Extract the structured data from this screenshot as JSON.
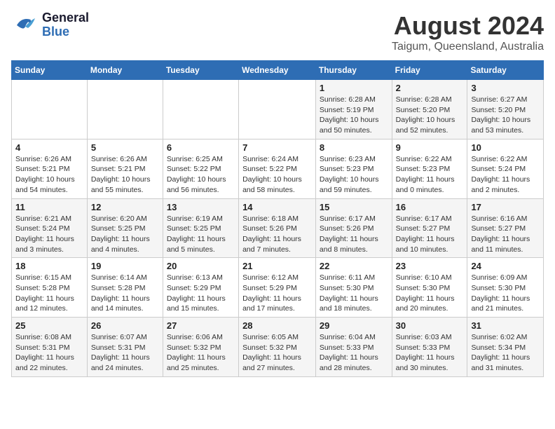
{
  "logo": {
    "part1": "General",
    "part2": "Blue"
  },
  "title": {
    "month_year": "August 2024",
    "location": "Taigum, Queensland, Australia"
  },
  "headers": [
    "Sunday",
    "Monday",
    "Tuesday",
    "Wednesday",
    "Thursday",
    "Friday",
    "Saturday"
  ],
  "weeks": [
    [
      {
        "day": "",
        "info": ""
      },
      {
        "day": "",
        "info": ""
      },
      {
        "day": "",
        "info": ""
      },
      {
        "day": "",
        "info": ""
      },
      {
        "day": "1",
        "info": "Sunrise: 6:28 AM\nSunset: 5:19 PM\nDaylight: 10 hours\nand 50 minutes."
      },
      {
        "day": "2",
        "info": "Sunrise: 6:28 AM\nSunset: 5:20 PM\nDaylight: 10 hours\nand 52 minutes."
      },
      {
        "day": "3",
        "info": "Sunrise: 6:27 AM\nSunset: 5:20 PM\nDaylight: 10 hours\nand 53 minutes."
      }
    ],
    [
      {
        "day": "4",
        "info": "Sunrise: 6:26 AM\nSunset: 5:21 PM\nDaylight: 10 hours\nand 54 minutes."
      },
      {
        "day": "5",
        "info": "Sunrise: 6:26 AM\nSunset: 5:21 PM\nDaylight: 10 hours\nand 55 minutes."
      },
      {
        "day": "6",
        "info": "Sunrise: 6:25 AM\nSunset: 5:22 PM\nDaylight: 10 hours\nand 56 minutes."
      },
      {
        "day": "7",
        "info": "Sunrise: 6:24 AM\nSunset: 5:22 PM\nDaylight: 10 hours\nand 58 minutes."
      },
      {
        "day": "8",
        "info": "Sunrise: 6:23 AM\nSunset: 5:23 PM\nDaylight: 10 hours\nand 59 minutes."
      },
      {
        "day": "9",
        "info": "Sunrise: 6:22 AM\nSunset: 5:23 PM\nDaylight: 11 hours\nand 0 minutes."
      },
      {
        "day": "10",
        "info": "Sunrise: 6:22 AM\nSunset: 5:24 PM\nDaylight: 11 hours\nand 2 minutes."
      }
    ],
    [
      {
        "day": "11",
        "info": "Sunrise: 6:21 AM\nSunset: 5:24 PM\nDaylight: 11 hours\nand 3 minutes."
      },
      {
        "day": "12",
        "info": "Sunrise: 6:20 AM\nSunset: 5:25 PM\nDaylight: 11 hours\nand 4 minutes."
      },
      {
        "day": "13",
        "info": "Sunrise: 6:19 AM\nSunset: 5:25 PM\nDaylight: 11 hours\nand 5 minutes."
      },
      {
        "day": "14",
        "info": "Sunrise: 6:18 AM\nSunset: 5:26 PM\nDaylight: 11 hours\nand 7 minutes."
      },
      {
        "day": "15",
        "info": "Sunrise: 6:17 AM\nSunset: 5:26 PM\nDaylight: 11 hours\nand 8 minutes."
      },
      {
        "day": "16",
        "info": "Sunrise: 6:17 AM\nSunset: 5:27 PM\nDaylight: 11 hours\nand 10 minutes."
      },
      {
        "day": "17",
        "info": "Sunrise: 6:16 AM\nSunset: 5:27 PM\nDaylight: 11 hours\nand 11 minutes."
      }
    ],
    [
      {
        "day": "18",
        "info": "Sunrise: 6:15 AM\nSunset: 5:28 PM\nDaylight: 11 hours\nand 12 minutes."
      },
      {
        "day": "19",
        "info": "Sunrise: 6:14 AM\nSunset: 5:28 PM\nDaylight: 11 hours\nand 14 minutes."
      },
      {
        "day": "20",
        "info": "Sunrise: 6:13 AM\nSunset: 5:29 PM\nDaylight: 11 hours\nand 15 minutes."
      },
      {
        "day": "21",
        "info": "Sunrise: 6:12 AM\nSunset: 5:29 PM\nDaylight: 11 hours\nand 17 minutes."
      },
      {
        "day": "22",
        "info": "Sunrise: 6:11 AM\nSunset: 5:30 PM\nDaylight: 11 hours\nand 18 minutes."
      },
      {
        "day": "23",
        "info": "Sunrise: 6:10 AM\nSunset: 5:30 PM\nDaylight: 11 hours\nand 20 minutes."
      },
      {
        "day": "24",
        "info": "Sunrise: 6:09 AM\nSunset: 5:30 PM\nDaylight: 11 hours\nand 21 minutes."
      }
    ],
    [
      {
        "day": "25",
        "info": "Sunrise: 6:08 AM\nSunset: 5:31 PM\nDaylight: 11 hours\nand 22 minutes."
      },
      {
        "day": "26",
        "info": "Sunrise: 6:07 AM\nSunset: 5:31 PM\nDaylight: 11 hours\nand 24 minutes."
      },
      {
        "day": "27",
        "info": "Sunrise: 6:06 AM\nSunset: 5:32 PM\nDaylight: 11 hours\nand 25 minutes."
      },
      {
        "day": "28",
        "info": "Sunrise: 6:05 AM\nSunset: 5:32 PM\nDaylight: 11 hours\nand 27 minutes."
      },
      {
        "day": "29",
        "info": "Sunrise: 6:04 AM\nSunset: 5:33 PM\nDaylight: 11 hours\nand 28 minutes."
      },
      {
        "day": "30",
        "info": "Sunrise: 6:03 AM\nSunset: 5:33 PM\nDaylight: 11 hours\nand 30 minutes."
      },
      {
        "day": "31",
        "info": "Sunrise: 6:02 AM\nSunset: 5:34 PM\nDaylight: 11 hours\nand 31 minutes."
      }
    ]
  ]
}
